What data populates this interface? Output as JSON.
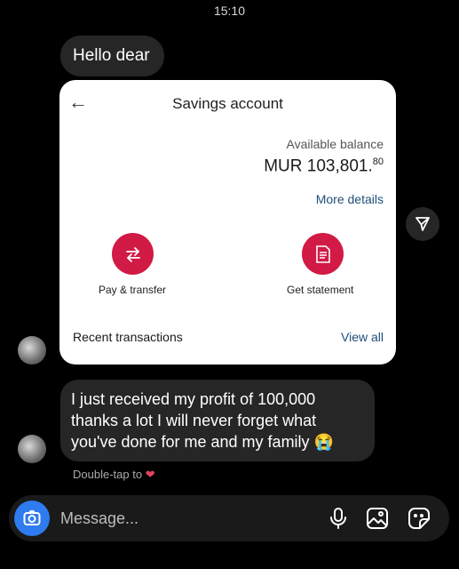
{
  "status_bar": {
    "time": "15:10"
  },
  "messages": [
    {
      "text": "Hello dear"
    },
    {
      "text": "I just received my profit of 100,000 thanks a lot I will never forget what you've done for me and my family 😭"
    }
  ],
  "shared_screenshot": {
    "title": "Savings account",
    "available_balance_label": "Available balance",
    "balance_main": "MUR 103,801.",
    "balance_cents": "80",
    "more_details": "More details",
    "actions": [
      {
        "label": "Pay & transfer"
      },
      {
        "label": "Get statement"
      }
    ],
    "recent_transactions": "Recent transactions",
    "view_all": "View all"
  },
  "reaction_hint": "Double-tap to",
  "composer": {
    "placeholder": "Message..."
  },
  "colors": {
    "accent": "#d11a45",
    "link": "#1f4e79",
    "camera": "#2f7bf0"
  }
}
